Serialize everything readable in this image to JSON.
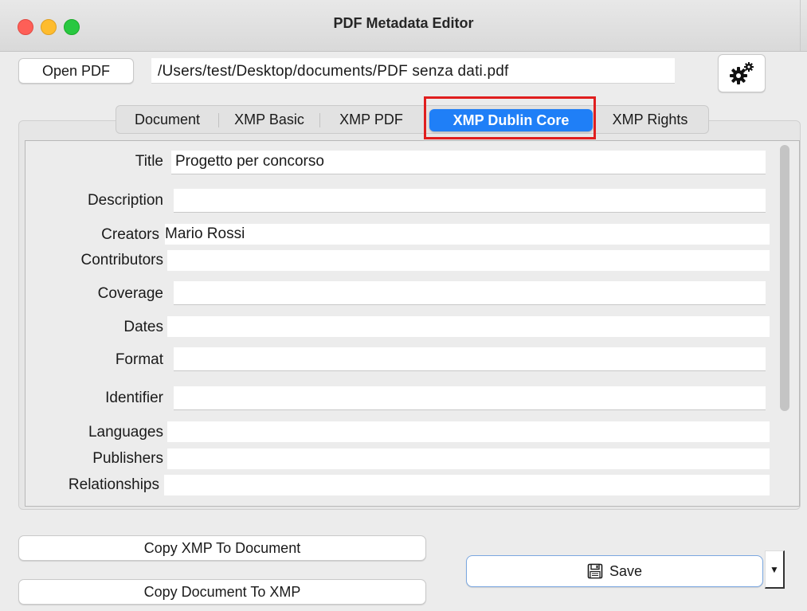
{
  "window": {
    "title": "PDF Metadata Editor"
  },
  "toolbar": {
    "open_label": "Open PDF",
    "file_path": "/Users/test/Desktop/documents/PDF senza dati.pdf",
    "settings_icon": "gears-icon"
  },
  "tabs": [
    {
      "label": "Document"
    },
    {
      "label": "XMP Basic"
    },
    {
      "label": "XMP PDF"
    },
    {
      "label": "XMP Dublin Core"
    },
    {
      "label": "XMP Rights"
    }
  ],
  "active_tab": "XMP Dublin Core",
  "fields": {
    "title": {
      "label": "Title",
      "value": "Progetto per concorso"
    },
    "description": {
      "label": "Description",
      "value": ""
    },
    "creators": {
      "label": "Creators",
      "value": "Mario Rossi"
    },
    "contributors": {
      "label": "Contributors",
      "value": ""
    },
    "coverage": {
      "label": "Coverage",
      "value": ""
    },
    "dates": {
      "label": "Dates",
      "value": ""
    },
    "format": {
      "label": "Format",
      "value": ""
    },
    "identifier": {
      "label": "Identifier",
      "value": ""
    },
    "languages": {
      "label": "Languages",
      "value": ""
    },
    "publishers": {
      "label": "Publishers",
      "value": ""
    },
    "relationships": {
      "label": "Relationships",
      "value": ""
    }
  },
  "actions": {
    "copy_xmp_to_doc": "Copy XMP To Document",
    "copy_doc_to_xmp": "Copy Document To XMP",
    "save": "Save",
    "save_icon": "floppy-disk-icon",
    "save_menu_icon": "dropdown-arrow-icon"
  },
  "colors": {
    "accent": "#1f7ff7",
    "highlight": "#e01e1e"
  }
}
